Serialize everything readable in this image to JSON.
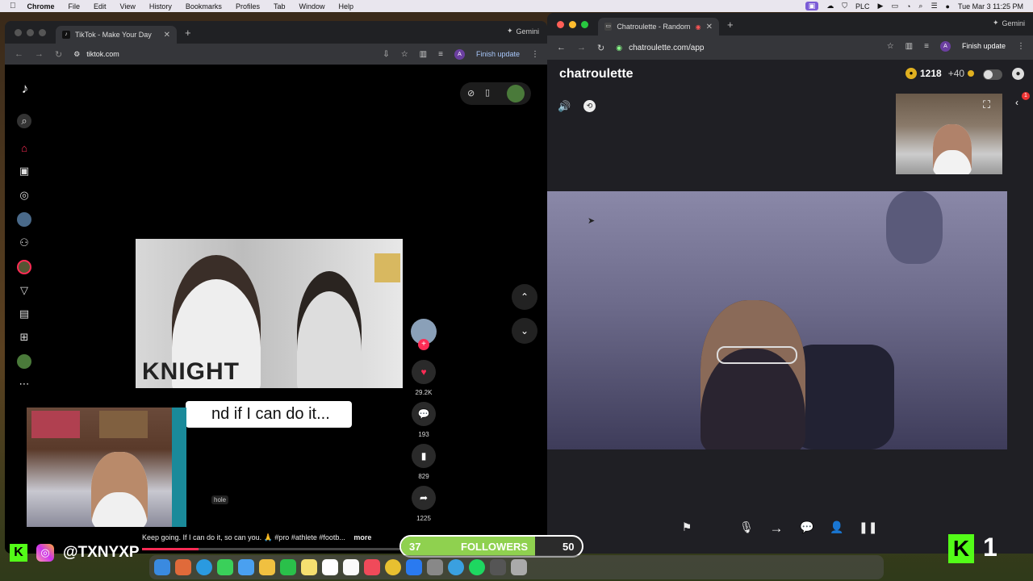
{
  "menubar": {
    "app_name": "Chrome",
    "items": [
      "File",
      "Edit",
      "View",
      "History",
      "Bookmarks",
      "Profiles",
      "Tab",
      "Window",
      "Help"
    ],
    "status_plc": "PLC",
    "clock": "Tue Mar 3  11:25 PM"
  },
  "tiktok_window": {
    "tab_title": "TikTok - Make Your Day",
    "url": "tiktok.com",
    "gemini_label": "Gemini",
    "finish_update": "Finish update",
    "profile_initial": "A",
    "caption_overlay": "nd if I can do it...",
    "jersey_text": "KNIGHT",
    "stats": {
      "likes": "29.2K",
      "comments": "193",
      "saves": "829",
      "shares": "1225"
    },
    "description": "Keep going. If I can do it, so can you. 🙏 #pro #athlete #footb...",
    "more_label": "more",
    "small_tag": "hole"
  },
  "chatroulette_window": {
    "tab_title": "Chatroulette - Random vi",
    "url": "chatroulette.com/app",
    "gemini_label": "Gemini",
    "finish_update": "Finish update",
    "profile_initial": "A",
    "brand": "chatroulette",
    "coins": "1218",
    "bonus": "+40",
    "notification_count": "1"
  },
  "stream_overlay": {
    "handle": "@TXNYXP",
    "followers_left": "37",
    "followers_label": "FOLLOWERS",
    "followers_right": "50",
    "score": "1"
  },
  "colors": {
    "tiktok_red": "#fe2c55",
    "chrome_dark": "#202124",
    "toolbar": "#35363a",
    "followers_green": "#8fd14f",
    "kick_green": "#53fc18"
  }
}
